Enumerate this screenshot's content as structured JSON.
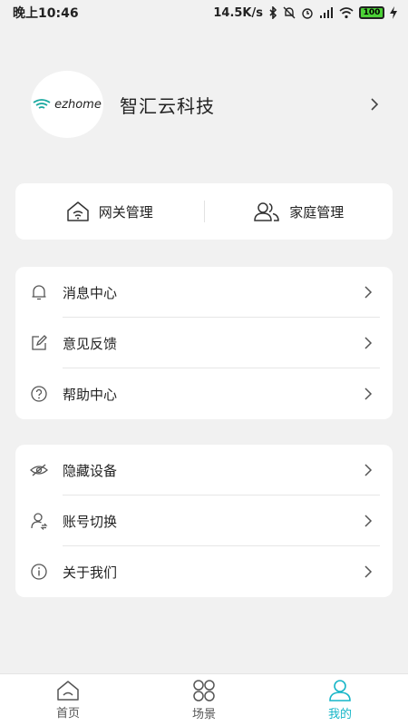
{
  "status": {
    "time": "晚上10:46",
    "speed": "14.5K/s",
    "battery": "100"
  },
  "profile": {
    "logo_text": "ezhome",
    "name": "智汇云科技"
  },
  "manage": {
    "gateway": "网关管理",
    "family": "家庭管理"
  },
  "menu_group_1": [
    {
      "label": "消息中心",
      "icon": "bell-icon"
    },
    {
      "label": "意见反馈",
      "icon": "edit-icon"
    },
    {
      "label": "帮助中心",
      "icon": "help-icon"
    }
  ],
  "menu_group_2": [
    {
      "label": "隐藏设备",
      "icon": "eye-hidden-icon"
    },
    {
      "label": "账号切换",
      "icon": "account-switch-icon"
    },
    {
      "label": "关于我们",
      "icon": "info-icon"
    }
  ],
  "tabs": [
    {
      "label": "首页",
      "icon": "home-icon",
      "active": false
    },
    {
      "label": "场景",
      "icon": "scene-icon",
      "active": false
    },
    {
      "label": "我的",
      "icon": "user-icon",
      "active": true
    }
  ],
  "colors": {
    "accent": "#17b6c8",
    "background": "#f1f1f1",
    "card": "#ffffff"
  }
}
